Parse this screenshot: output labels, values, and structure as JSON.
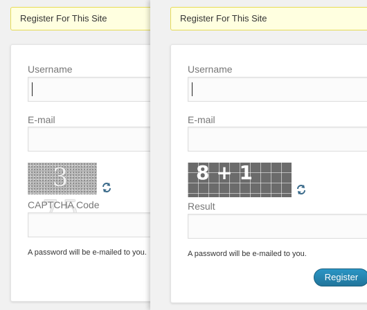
{
  "left": {
    "notice": "Register For This Site",
    "username_label": "Username",
    "email_label": "E-mail",
    "captcha_text": "3 75",
    "captcha_label": "CAPTCHA Code",
    "note": "A password will be e-mailed to you."
  },
  "right": {
    "notice": "Register For This Site",
    "username_label": "Username",
    "email_label": "E-mail",
    "captcha_text": "8 + 1",
    "result_label": "Result",
    "note": "A password will be e-mailed to you.",
    "register_label": "Register"
  },
  "colors": {
    "accent": "#21759b",
    "notice_bg": "#ffffe0"
  }
}
